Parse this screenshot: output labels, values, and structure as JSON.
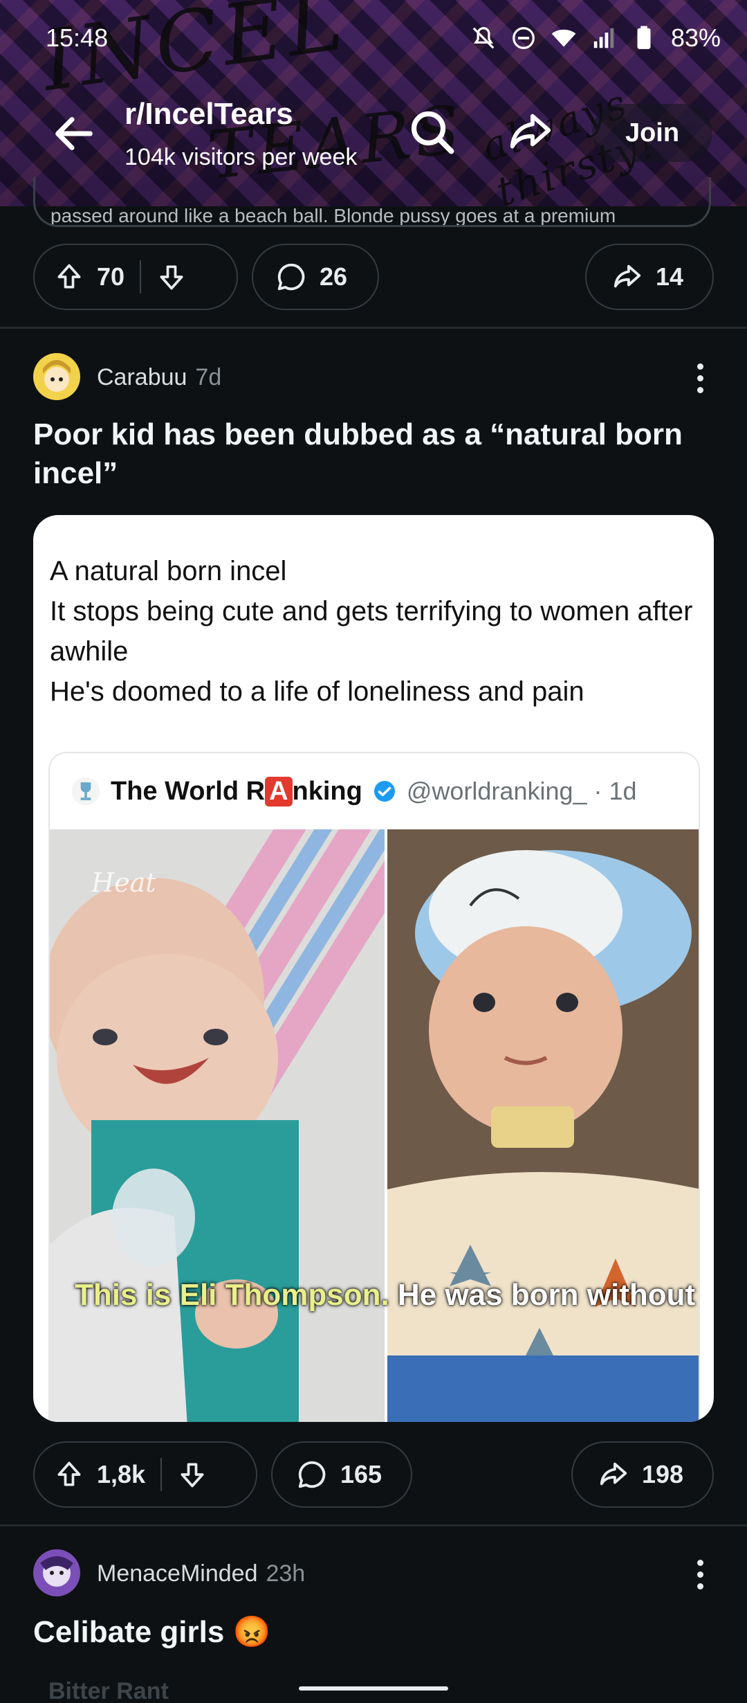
{
  "status_bar": {
    "time": "15:48",
    "battery": "83%"
  },
  "header": {
    "subreddit": "r/IncelTears",
    "visitors": "104k visitors per week",
    "join_label": "Join",
    "banner_scrawl_1": "INCEL",
    "banner_scrawl_2": "TEARS",
    "banner_scrawl_3": "always thirsty!"
  },
  "previous_post": {
    "snippet": "passed around like a beach ball. Blonde pussy goes at a premium",
    "upvotes": "70",
    "comments": "26",
    "shares": "14"
  },
  "post": {
    "author": "Carabuu",
    "age": "7d",
    "title": "Poor kid has been dubbed as a “natural born incel”",
    "tweet_text": "A natural born incel\nIt stops being cute and gets terrifying to women after awhile\nHe's doomed to a life of loneliness and pain",
    "quote_name_a": "The World R",
    "quote_name_box": "A",
    "quote_name_b": "nking",
    "quote_handle": "@worldranking_ · 1d",
    "photo_watermark": "Heat",
    "caption_highlight": "This is Eli Thompson.",
    "caption_rest": " He was born without",
    "upvotes": "1,8k",
    "comments": "165",
    "shares": "198"
  },
  "next_post": {
    "author": "MenaceMinded",
    "age": "23h",
    "title": "Celibate girls 😡",
    "peek": "Bitter Rant"
  },
  "colors": {
    "background": "#0e1113",
    "pill_border": "#343b40",
    "caption_highlight": "#e9ef8a"
  }
}
